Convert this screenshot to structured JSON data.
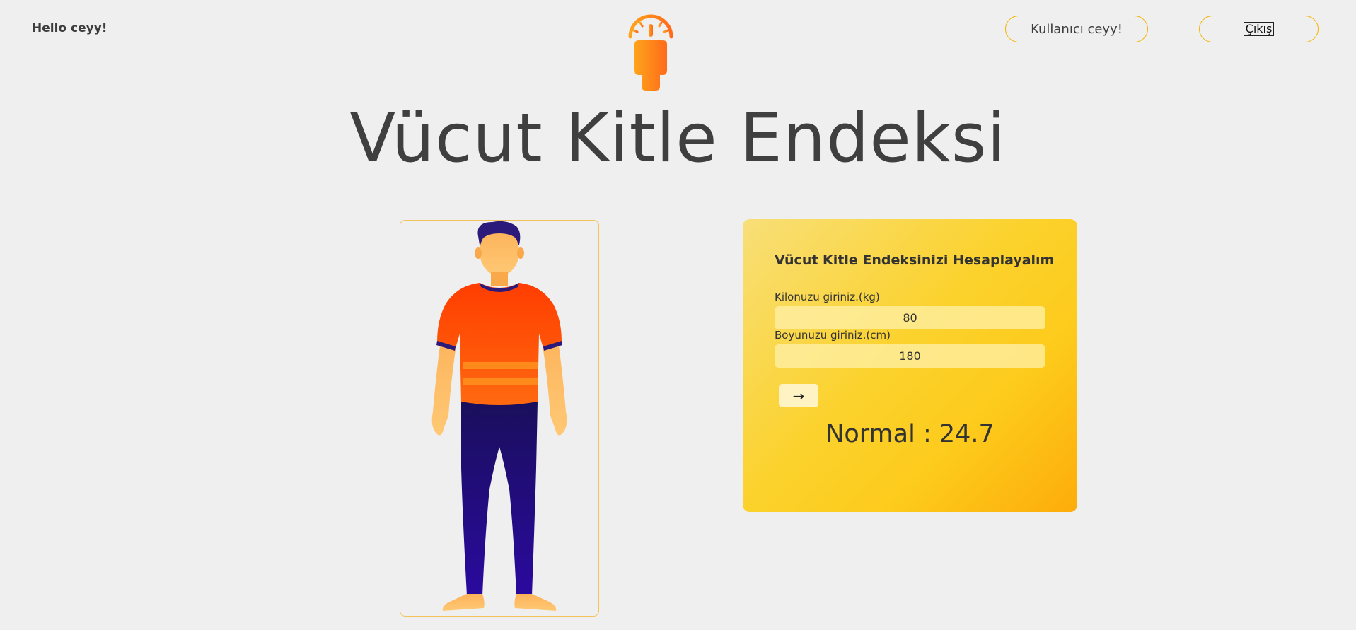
{
  "header": {
    "greeting": "Hello ceyy!",
    "user_button_label": "Kullanıcı ceyy!",
    "logout_button_label": "Çıkış",
    "logo_icon": "bmi-scale-person-icon"
  },
  "page": {
    "title": "Vücut Kitle Endeksi"
  },
  "illustration": {
    "name": "standing-man-illustration"
  },
  "form": {
    "title": "Vücut Kitle Endeksinizi Hesaplayalım",
    "weight_label": "Kilonuzu giriniz.(kg)",
    "weight_value": "80",
    "height_label": "Boyunuzu giriniz.(cm)",
    "height_value": "180",
    "submit_label": "→",
    "result_text": "Normal : 24.7"
  },
  "colors": {
    "accent": "#f5b300",
    "background": "#efefef",
    "card_gradient_start": "#f8df78",
    "card_gradient_end": "#fdac0a",
    "text": "#3f3f3f"
  }
}
